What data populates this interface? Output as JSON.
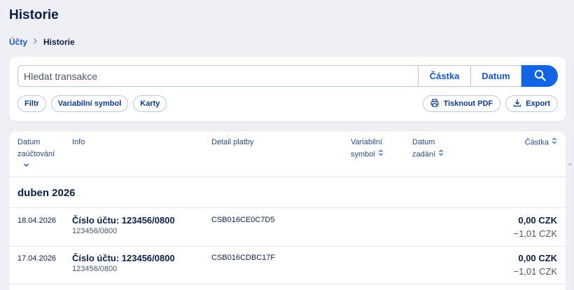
{
  "page": {
    "title": "Historie"
  },
  "breadcrumb": {
    "parent": "Účty",
    "current": "Historie"
  },
  "search": {
    "placeholder": "Hledat transakce",
    "amount_label": "Částka",
    "date_label": "Datum"
  },
  "filters": [
    {
      "label": "Filtr"
    },
    {
      "label": "Variabilní symbol"
    },
    {
      "label": "Karty"
    }
  ],
  "actions": {
    "print_label": "Tisknout PDF",
    "export_label": "Export"
  },
  "table": {
    "columns": {
      "posting_date_line1": "Datum",
      "posting_date_line2": "zaúčtování",
      "info": "Info",
      "detail": "Detail platby",
      "vs_line1": "Variabilní",
      "vs_line2": "symbol",
      "entry_date_line1": "Datum",
      "entry_date_line2": "zadání",
      "amount": "Částka"
    },
    "month": "duben 2026",
    "rows": [
      {
        "date": "18.04.2026",
        "title": "Číslo účtu: 123456/0800",
        "subtitle": "123456/0800",
        "detail": "CSB016CE0C7D5",
        "amount": "0,00 CZK",
        "fee": "−1,01 CZK"
      },
      {
        "date": "17.04.2026",
        "title": "Číslo účtu: 123456/0800",
        "subtitle": "123456/0800",
        "detail": "CSB016CDBC17F",
        "amount": "0,00 CZK",
        "fee": "−1,01 CZK"
      }
    ]
  },
  "side": {
    "chevrons": "«"
  },
  "colors": {
    "accent": "#1264e6",
    "link": "#1a56c8",
    "text": "#0b1f44",
    "background": "#eef0f5"
  }
}
